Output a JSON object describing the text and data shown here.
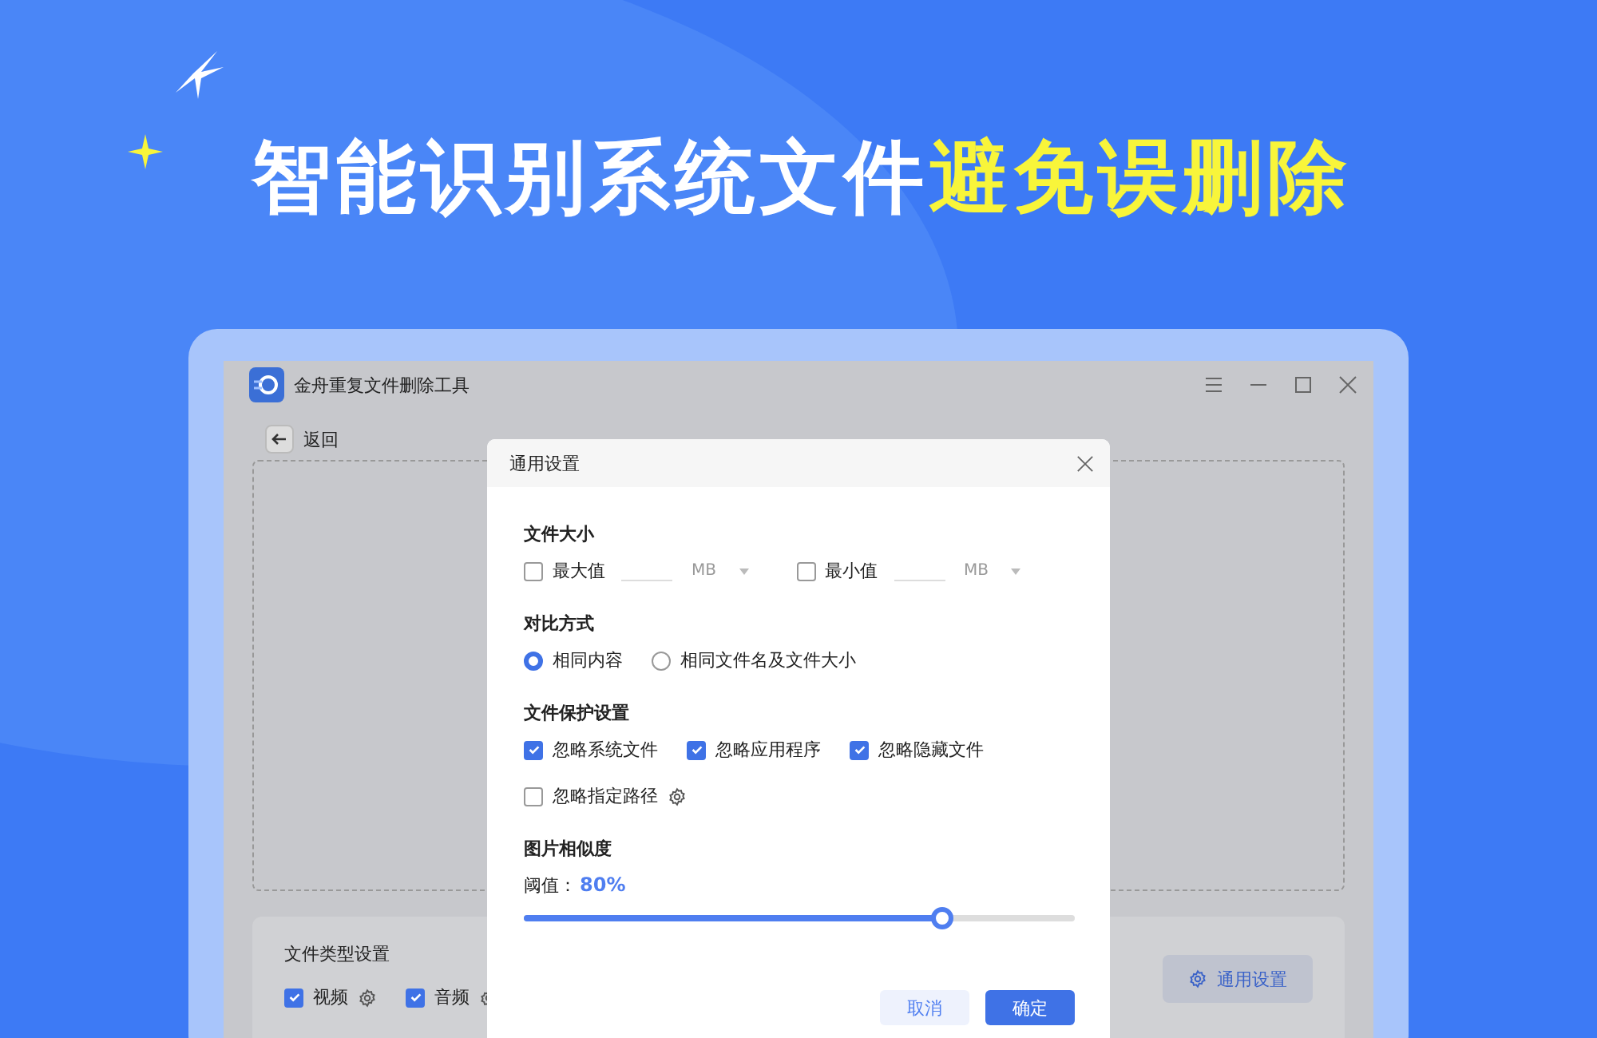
{
  "headline": {
    "white": "智能识别系统文件",
    "yellow": "避免误删除"
  },
  "window": {
    "title": "金舟重复文件删除工具",
    "back": "返回"
  },
  "file_types": {
    "title": "文件类型设置",
    "items": [
      {
        "label": "视频",
        "checked": true
      },
      {
        "label": "音频",
        "checked": true
      }
    ]
  },
  "general_button": "通用设置",
  "dialog": {
    "title": "通用设置",
    "size": {
      "title": "文件大小",
      "items": [
        {
          "label": "最大值",
          "checked": false,
          "unit": "MB"
        },
        {
          "label": "最小值",
          "checked": false,
          "unit": "MB"
        }
      ]
    },
    "compare": {
      "title": "对比方式",
      "options": [
        {
          "label": "相同内容",
          "selected": true
        },
        {
          "label": "相同文件名及文件大小",
          "selected": false
        }
      ]
    },
    "protect": {
      "title": "文件保护设置",
      "items": [
        {
          "label": "忽略系统文件",
          "checked": true,
          "gear": false
        },
        {
          "label": "忽略应用程序",
          "checked": true,
          "gear": false
        },
        {
          "label": "忽略隐藏文件",
          "checked": true,
          "gear": false
        },
        {
          "label": "忽略指定路径",
          "checked": false,
          "gear": true
        }
      ]
    },
    "similarity": {
      "title": "图片相似度",
      "label": "阈值：",
      "value": "80%",
      "level": 0.76
    },
    "buttons": [
      {
        "label": "取消",
        "kind": "secondary"
      },
      {
        "label": "确定",
        "kind": "primary"
      }
    ]
  }
}
